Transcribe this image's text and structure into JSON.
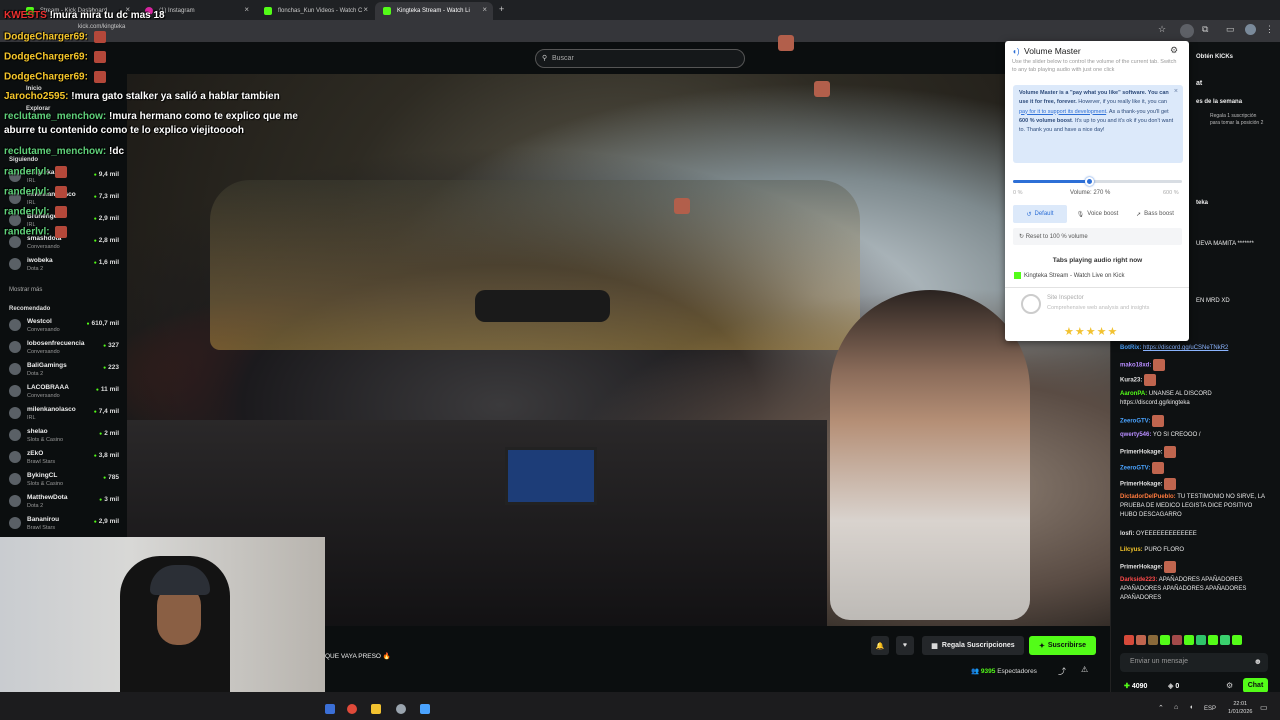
{
  "browser": {
    "tabs": [
      {
        "label": "Stream - Kick Dashboard",
        "color": "#53fc18"
      },
      {
        "label": "(1) Instagram",
        "color": "#d6249f"
      },
      {
        "label": "flonchas_Kun Videos - Watch C",
        "color": "#53fc18"
      },
      {
        "label": "Kingteka Stream - Watch Li",
        "color": "#53fc18"
      }
    ],
    "url": "kick.com/kingteka",
    "new_tab": "+"
  },
  "kick": {
    "search_placeholder": "Buscar",
    "nav": {
      "home": "Inicio",
      "explore": "Explorar",
      "following": "Siguiendo",
      "show_more": "Mostrar más",
      "recommended": "Recomendado"
    },
    "following": [
      {
        "name": "Kingteka",
        "category": "IRL",
        "viewers": "9,4 mil"
      },
      {
        "name": "milenkanolasco",
        "category": "IRL",
        "viewers": "7,3 mil"
      },
      {
        "name": "Brunenger",
        "category": "IRL",
        "viewers": "2,9 mil"
      },
      {
        "name": "smashdota",
        "category": "Conversando",
        "viewers": "2,8 mil"
      },
      {
        "name": "iwobeka",
        "category": "Dota 2",
        "viewers": "1,6 mil"
      }
    ],
    "recommended": [
      {
        "name": "Westcol",
        "category": "Conversando",
        "viewers": "610,7 mil"
      },
      {
        "name": "lobosenfrecuencia",
        "category": "Conversando",
        "viewers": "327"
      },
      {
        "name": "BaliGamings",
        "category": "Dota 2",
        "viewers": "223"
      },
      {
        "name": "LACOBRAAA",
        "category": "Conversando",
        "viewers": "11 mil"
      },
      {
        "name": "milenkanolasco",
        "category": "IRL",
        "viewers": "7,4 mil"
      },
      {
        "name": "shelao",
        "category": "Slots & Casino",
        "viewers": "2 mil"
      },
      {
        "name": "zEkO",
        "category": "Brawl Stars",
        "viewers": "3,8 mil"
      },
      {
        "name": "BykingCL",
        "category": "Slots & Casino",
        "viewers": "785"
      },
      {
        "name": "MatthewDota",
        "category": "Dota 2",
        "viewers": "3 mil"
      },
      {
        "name": "Bananirou",
        "category": "Brawl Stars",
        "viewers": "2,9 mil"
      }
    ],
    "ticker": "QUE VAYA PRESO 🔥",
    "gift_button": "Regala Suscripciones",
    "subscribe_button": "Suscribirse",
    "viewers_count": "9395",
    "viewers_label": "Espectadores"
  },
  "overlay_chat": [
    {
      "user": "KWESTS",
      "text": "!mura mira tu dc mas 18",
      "color": "#e9302f"
    },
    {
      "user": "DodgeCharger69:",
      "text": "",
      "color": "#f5c62a"
    },
    {
      "user": "DodgeCharger69:",
      "text": "",
      "color": "#f5c62a"
    },
    {
      "user": "DodgeCharger69:",
      "text": "",
      "color": "#f5c62a"
    },
    {
      "user": "Jarocho2595:",
      "text": "!mura gato stalker ya salió a hablar tambien",
      "color": "#f5c62a"
    },
    {
      "user": "reclutame_menchow:",
      "text": "!mura hermano como te explico que me",
      "color": "#5fd17a"
    },
    {
      "user": "",
      "text": "aburre tu contenido como te lo explico viejitooooh",
      "color": "#ffffff"
    },
    {
      "user": "reclutame_menchow:",
      "text": "!dc",
      "color": "#5fd17a"
    },
    {
      "user": "randerlvl:",
      "text": "",
      "color": "#5fd17a"
    },
    {
      "user": "randerlvl:",
      "text": "",
      "color": "#5fd17a"
    },
    {
      "user": "randerlvl:",
      "text": "",
      "color": "#5fd17a"
    },
    {
      "user": "randerlvl:",
      "text": "",
      "color": "#5fd17a"
    }
  ],
  "chat_side": {
    "cta": "Obtén KICKs",
    "title_fragment": "at",
    "week_label": "es de la semana",
    "gift_cta": "Regala 1 suscripción para tomar la posición 2",
    "user_fragment": "teka",
    "line1": "UEVA MAMITA *******",
    "line2": "EN MRD XD"
  },
  "chat_messages": [
    {
      "user": "BotRix:",
      "text": "https://discord.gg/uCSNeTNkR2",
      "color": "#4aa3ff",
      "link": true
    },
    {
      "user": "mako18xd:",
      "text": "",
      "color": "#b78cff"
    },
    {
      "user": "Kura23:",
      "text": "",
      "color": "#e0e0e0"
    },
    {
      "user": "AaronPA:",
      "text": "UNANSE AL DISCORD https://discord.gg/kingteka",
      "color": "#53fc18"
    },
    {
      "user": "ZeeroGTV:",
      "text": "",
      "color": "#4aa3ff"
    },
    {
      "user": "qwerty546:",
      "text": "YO SI CREOOO /",
      "color": "#b78cff"
    },
    {
      "user": "ZeeroGTV:",
      "text": "",
      "color": "#4aa3ff"
    },
    {
      "user": "PrimerHokage:",
      "text": "",
      "color": "#e0e0e0"
    },
    {
      "user": "PrimerHokage:",
      "text": "",
      "color": "#e0e0e0"
    },
    {
      "user": "DictadorDelPueblo:",
      "text": "TU TESTIMONIO NO SIRVE, LA PRUEBA DE MEDICO LEGISTA DICE POSITIVO HUBO DESCAGARRO",
      "color": "#ff7a3d"
    },
    {
      "user": "losfi:",
      "text": "OYEEEEEEEEEEEEE",
      "color": "#e0e0e0"
    },
    {
      "user": "Lilcyus:",
      "text": "PURO FLORO",
      "color": "#f5c62a"
    },
    {
      "user": "PrimerHokage:",
      "text": "",
      "color": "#e0e0e0"
    },
    {
      "user": "Darkside223:",
      "text": "APAÑADORES APAÑADORES APAÑADORES APAÑADORES APAÑADORES APAÑADORES",
      "color": "#ff4a4a"
    }
  ],
  "chat_input_placeholder": "Enviar un mensaje",
  "kick_points": "4090",
  "kicks_count": "0",
  "chat_button": "Chat",
  "volume_master": {
    "title": "Volume Master",
    "description": "Use the slider below to control the volume of the current tab. Switch to any tab playing audio with just one click",
    "note_bold": "Volume Master is a \"pay what you like\" software. You can use it for free, forever.",
    "note_mid": " However, if you really like it, you can ",
    "note_link": "pay for it to support its development",
    "note_rest": ". As a thank-you you'll get ",
    "note_bold2": "600 % volume boost",
    "note_end": ". It's up to you and it's ok if you don't want to. Thank you and have a nice day!",
    "volume_min": "0 %",
    "volume_label": "Volume: 270 %",
    "volume_max": "600 %",
    "volume_fraction": 0.45,
    "modes": {
      "default": "Default",
      "voice": "Voice boost",
      "bass": "Bass boost"
    },
    "reset_label": "Reset to 100 % volume",
    "tabs_heading": "Tabs playing audio right now",
    "tab_item": "Kingteka Stream - Watch Live on Kick",
    "site_inspector_title": "Site Inspector",
    "site_inspector_sub": "Comprehensive web analysis and insights",
    "stars": "★★★★★"
  },
  "taskbar": {
    "lang": "ESP",
    "time": "22:01",
    "date": "1/01/2026"
  },
  "colors": {
    "kick_green": "#53fc18",
    "vm_blue": "#2d6fd6"
  }
}
